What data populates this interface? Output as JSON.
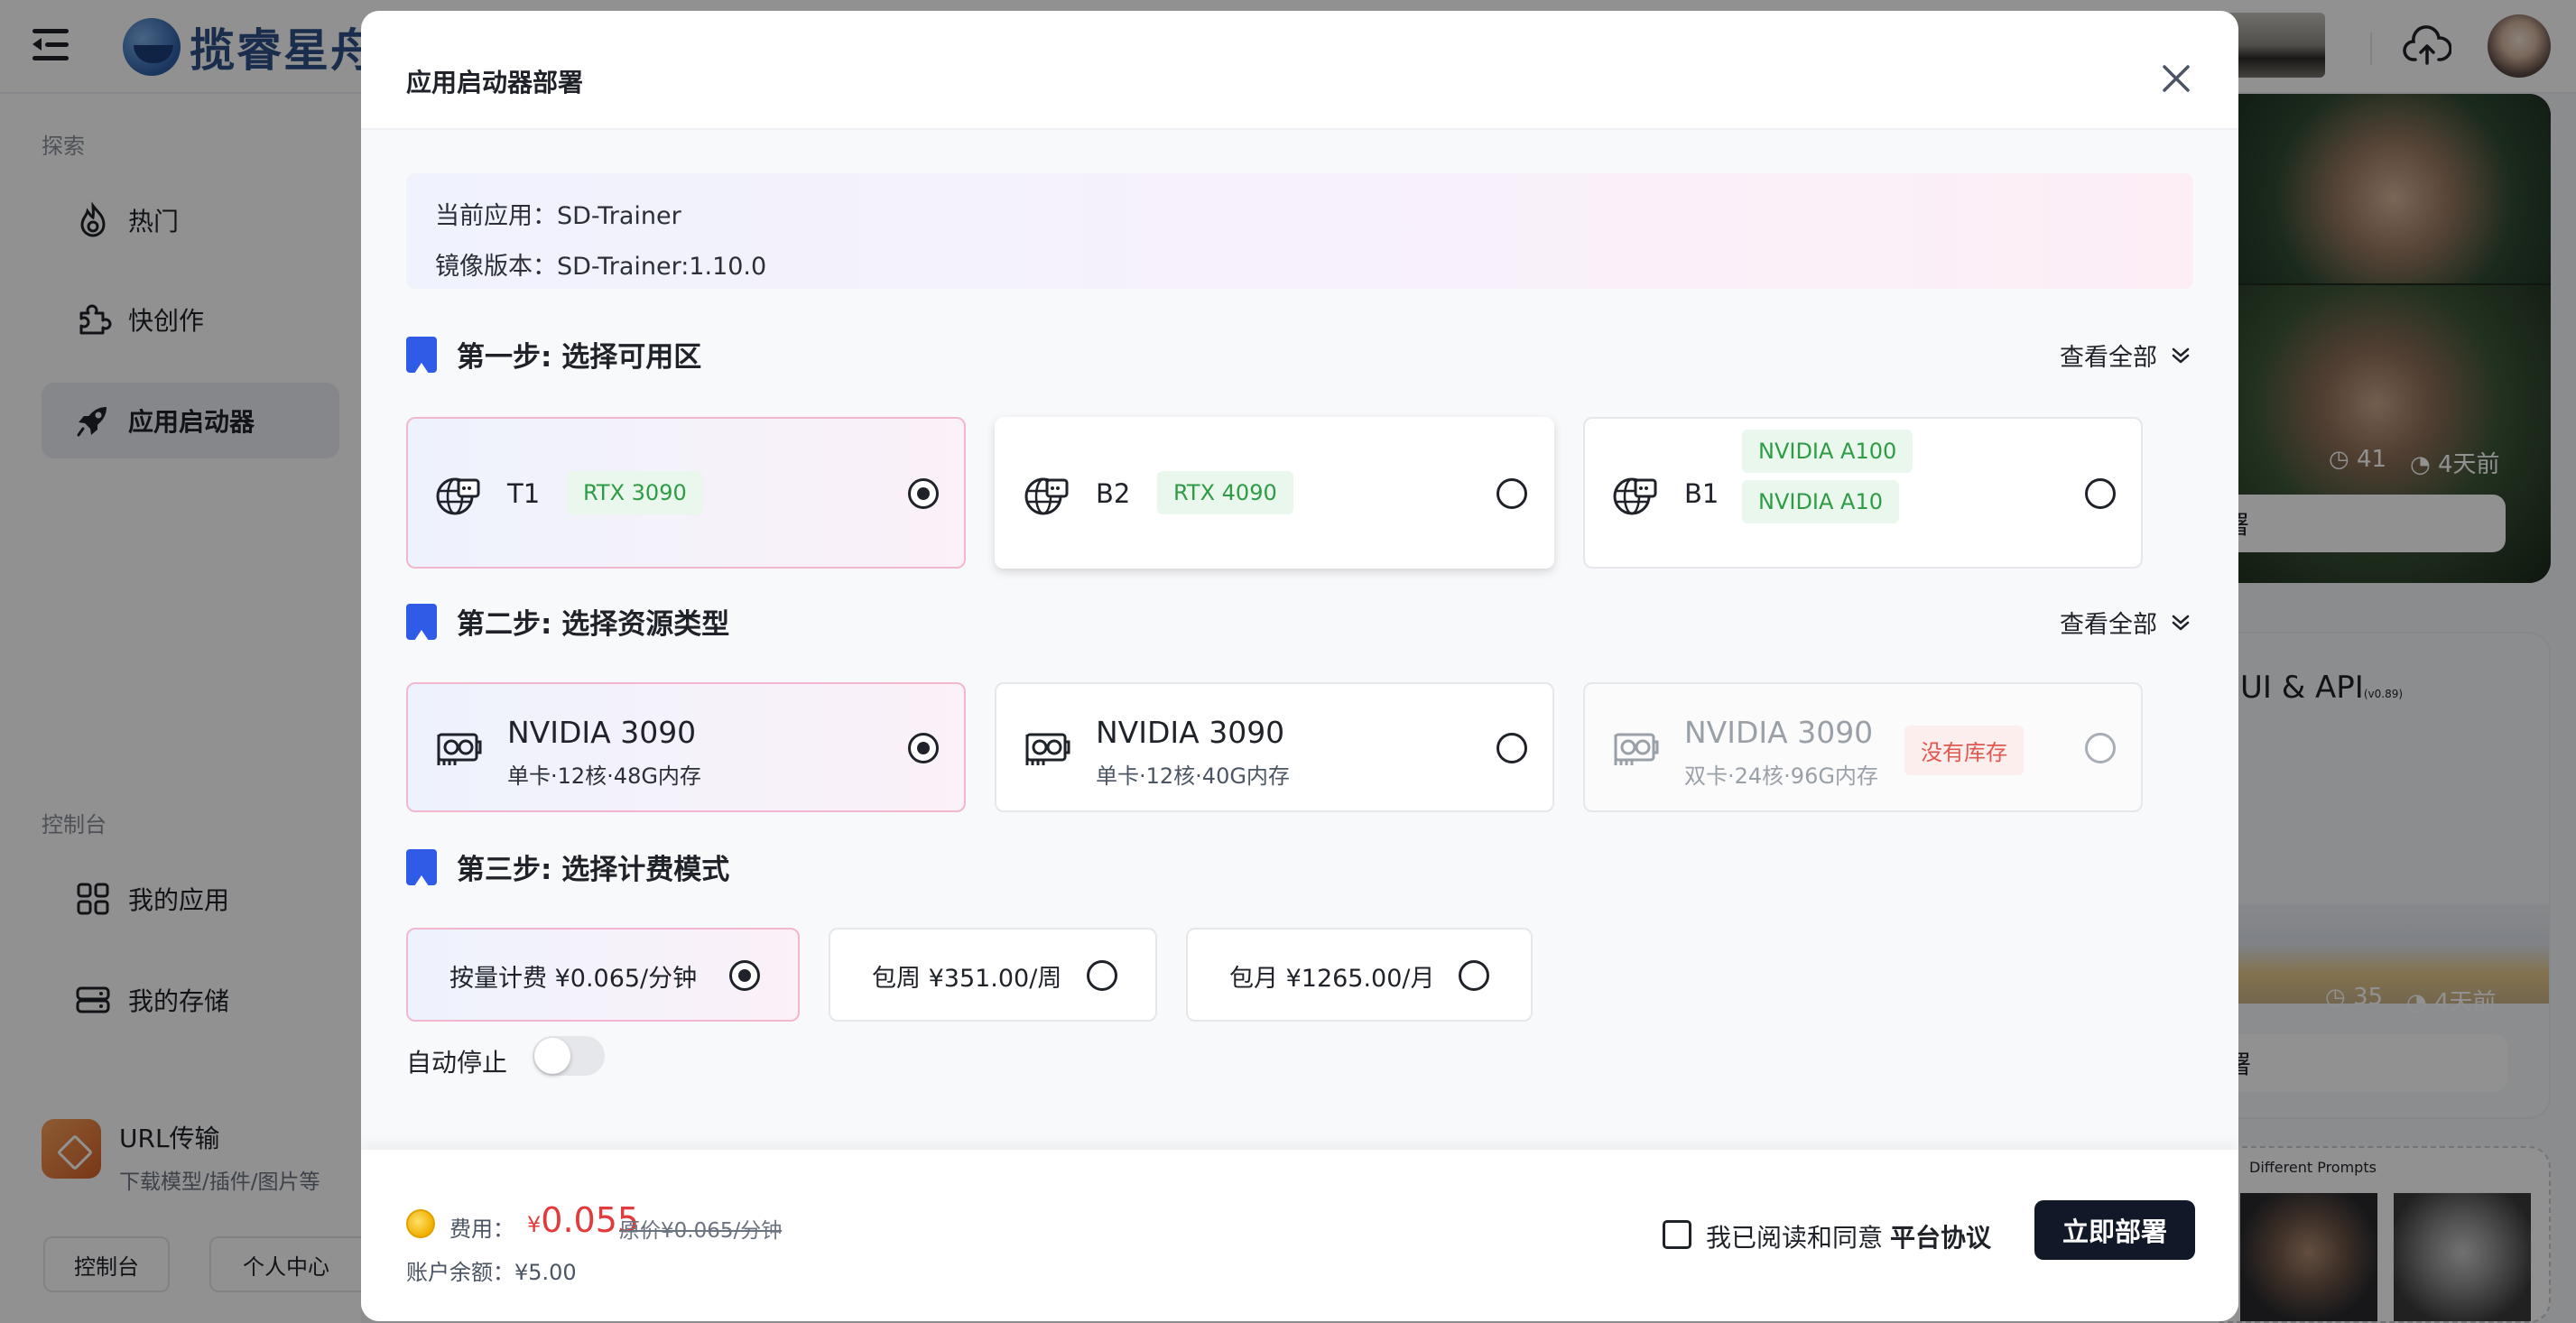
{
  "background": {
    "logo_text": "揽睿星舟",
    "sidebar": {
      "section_explore": "探索",
      "items_explore": [
        {
          "label": "热门",
          "icon": "flame-icon"
        },
        {
          "label": "快创作",
          "icon": "puzzle-icon"
        },
        {
          "label": "应用启动器",
          "icon": "rocket-icon",
          "active": true
        }
      ],
      "section_console": "控制台",
      "items_console": [
        {
          "label": "我的应用",
          "icon": "grid-icon"
        },
        {
          "label": "我的存储",
          "icon": "storage-icon"
        }
      ],
      "url_card": {
        "title": "URL传输",
        "subtitle": "下载模型/插件/图片等"
      },
      "bottom_buttons": [
        "控制台",
        "个人中心"
      ]
    },
    "feed": {
      "card1": {
        "views": "41",
        "time": "4天前",
        "button": "署"
      },
      "card2": {
        "title": "UI & API",
        "version": "(v0.89)",
        "views": "35",
        "time": "4天前",
        "button": "署"
      },
      "card3": {
        "caption": "Different Prompts"
      }
    }
  },
  "modal": {
    "title": "应用启动器部署",
    "app_info": {
      "current_app_label": "当前应用：",
      "current_app": "SD-Trainer",
      "image_version_label": "镜像版本：",
      "image_version": "SD-Trainer:1.10.0"
    },
    "view_all": "查看全部",
    "step1": {
      "title": "第一步: 选择可用区",
      "zones": [
        {
          "name": "T1",
          "gpus": [
            "RTX 3090"
          ],
          "selected": true
        },
        {
          "name": "B2",
          "gpus": [
            "RTX 4090"
          ],
          "selected": false
        },
        {
          "name": "B1",
          "gpus": [
            "NVIDIA A100",
            "NVIDIA A10"
          ],
          "selected": false
        }
      ]
    },
    "step2": {
      "title": "第二步: 选择资源类型",
      "resources": [
        {
          "name": "NVIDIA 3090",
          "spec": "单卡·12核·48G内存",
          "selected": true,
          "stock": ""
        },
        {
          "name": "NVIDIA 3090",
          "spec": "单卡·12核·40G内存",
          "selected": false,
          "stock": ""
        },
        {
          "name": "NVIDIA 3090",
          "spec": "双卡·24核·96G内存",
          "selected": false,
          "stock": "没有库存"
        }
      ]
    },
    "step3": {
      "title": "第三步: 选择计费模式",
      "billing": [
        {
          "label": "按量计费 ¥0.065/分钟",
          "selected": true
        },
        {
          "label": "包周 ¥351.00/周",
          "selected": false
        },
        {
          "label": "包月 ¥1265.00/月",
          "selected": false
        }
      ]
    },
    "auto_stop_label": "自动停止",
    "auto_stop_on": false,
    "footer": {
      "fee_label": "费用：",
      "fee_currency": "¥",
      "fee_value": "0.055",
      "original_price": "原价¥0.065/分钟",
      "balance": "账户余额：¥5.00",
      "agree_text": "我已阅读和同意",
      "agree_link": "平台协议",
      "deploy_button": "立即部署"
    }
  },
  "colors": {
    "accent_blue": "#2f5be7",
    "tag_green": "#2e9b45",
    "price_red": "#e23b3b",
    "button_dark": "#111827"
  }
}
